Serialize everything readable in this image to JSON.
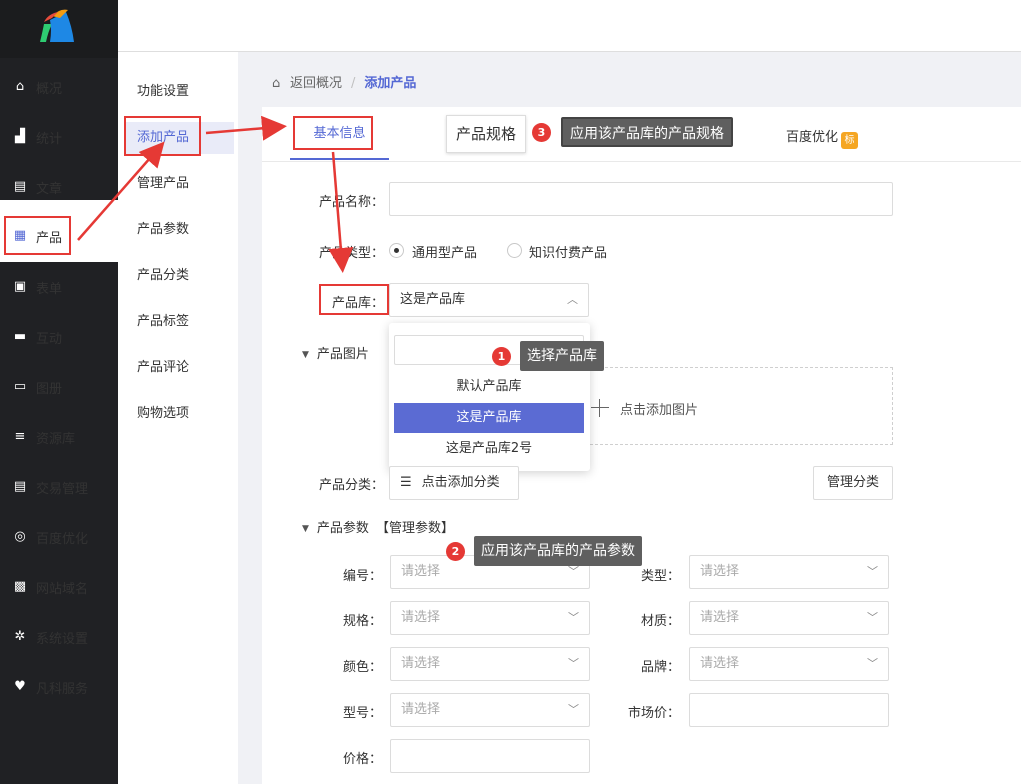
{
  "nav": {
    "items": [
      {
        "label": "概况",
        "icon": "home-icon"
      },
      {
        "label": "统计",
        "icon": "stats-icon"
      },
      {
        "label": "文章",
        "icon": "article-icon"
      },
      {
        "label": "产品",
        "icon": "product-icon"
      },
      {
        "label": "表单",
        "icon": "form-icon"
      },
      {
        "label": "互动",
        "icon": "chat-icon"
      },
      {
        "label": "图册",
        "icon": "gallery-icon"
      },
      {
        "label": "资源库",
        "icon": "database-icon"
      },
      {
        "label": "交易管理",
        "icon": "trade-icon"
      },
      {
        "label": "百度优化",
        "icon": "seo-icon"
      },
      {
        "label": "网站域名",
        "icon": "domain-icon"
      },
      {
        "label": "系统设置",
        "icon": "gear-icon"
      },
      {
        "label": "凡科服务",
        "icon": "heart-icon"
      }
    ],
    "active": "产品"
  },
  "subnav": {
    "items": [
      "功能设置",
      "添加产品",
      "管理产品",
      "产品参数",
      "产品分类",
      "产品标签",
      "产品评论",
      "购物选项"
    ],
    "active": "添加产品"
  },
  "breadcrumb": {
    "home": "返回概况",
    "current": "添加产品"
  },
  "tabs": {
    "basic": "基本信息",
    "spec": "产品规格",
    "baidu": "百度优化",
    "baidu_badge": "标"
  },
  "form": {
    "name_label": "产品名称：",
    "type_label": "产品类型：",
    "type_option_1": "通用型产品",
    "type_option_2": "知识付费产品",
    "library_label": "产品库：",
    "library_value": "这是产品库",
    "image_section": "产品图片",
    "upload_text": "点击添加图片",
    "category_label": "产品分类：",
    "category_button": "点击添加分类",
    "manage_category": "管理分类",
    "param_section": "产品参数",
    "manage_params": "【管理参数】",
    "params": [
      {
        "label": "编号：",
        "placeholder": "请选择"
      },
      {
        "label": "类型：",
        "placeholder": "请选择"
      },
      {
        "label": "规格：",
        "placeholder": "请选择"
      },
      {
        "label": "材质：",
        "placeholder": "请选择"
      },
      {
        "label": "颜色：",
        "placeholder": "请选择"
      },
      {
        "label": "品牌：",
        "placeholder": "请选择"
      },
      {
        "label": "型号：",
        "placeholder": "请选择"
      },
      {
        "label": "市场价：",
        "placeholder": ""
      },
      {
        "label": "价格：",
        "placeholder": ""
      }
    ]
  },
  "dropdown": {
    "options": [
      "默认产品库",
      "这是产品库",
      "这是产品库2号"
    ],
    "selected": "这是产品库"
  },
  "annotations": {
    "n1": "1",
    "tip1": "选择产品库",
    "n2": "2",
    "tip2": "应用该产品库的产品参数",
    "n3": "3",
    "tip3": "应用该产品库的产品规格"
  },
  "colors": {
    "accent": "#5468d4",
    "annotation_red": "#e53935",
    "sidebar_dark": "#202124"
  }
}
